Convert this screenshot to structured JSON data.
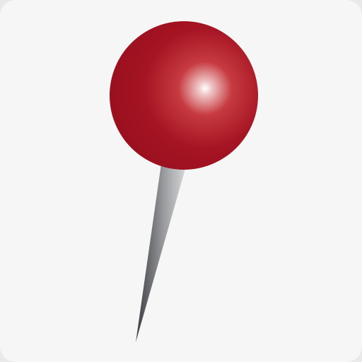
{
  "icon": {
    "name": "push-pin",
    "colors": {
      "background": "#f6f6f6",
      "pin_head": "#9e0f1e",
      "pin_head_highlight": "#ffffff",
      "needle_light": "#cfd0d2",
      "needle_dark": "#3b3e42"
    }
  }
}
